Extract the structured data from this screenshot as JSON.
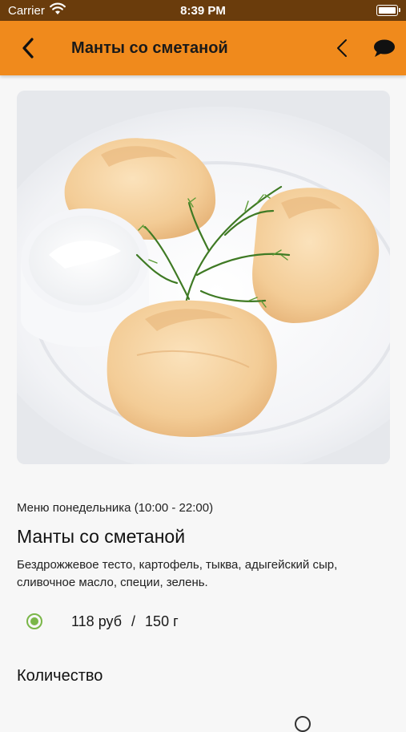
{
  "status_bar": {
    "carrier": "Carrier",
    "time": "8:39 PM"
  },
  "navbar": {
    "title": "Манты со сметаной",
    "accent_color": "#f08a1c"
  },
  "item": {
    "menu_name": "Меню понедельника (10:00 - 22:00)",
    "title": "Манты со сметаной",
    "description": "Бездрожжевое тесто, картофель, тыква, адыгейский сыр, сливочное масло, специи, зелень.",
    "option": {
      "selected": true,
      "price": "118 руб",
      "separator": "/",
      "weight": "150 г"
    }
  },
  "quantity": {
    "label": "Количество"
  },
  "icons": {
    "back": "chevron-left-icon",
    "share": "chevron-left-icon",
    "chat": "speech-bubble-icon"
  }
}
